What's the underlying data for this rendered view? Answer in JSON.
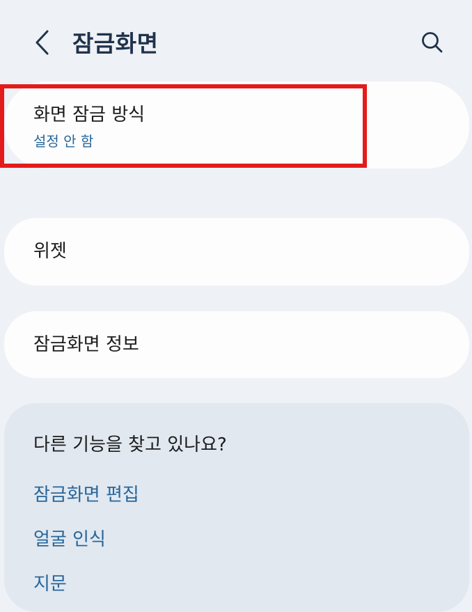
{
  "header": {
    "title": "잠금화면"
  },
  "lock_type": {
    "label": "화면 잠금 방식",
    "value": "설정 안 함"
  },
  "widgets": {
    "label": "위젯"
  },
  "lock_info": {
    "label": "잠금화면 정보"
  },
  "suggestions": {
    "title": "다른 기능을 찾고 있나요?",
    "links": [
      {
        "label": "잠금화면 편집"
      },
      {
        "label": "얼굴 인식"
      },
      {
        "label": "지문"
      }
    ]
  },
  "colors": {
    "background": "#eef1f5",
    "card": "#fdfdfd",
    "accent": "#28669a",
    "highlight": "#e41b1b"
  },
  "icons": {
    "back": "chevron-left-icon",
    "search": "search-icon"
  }
}
